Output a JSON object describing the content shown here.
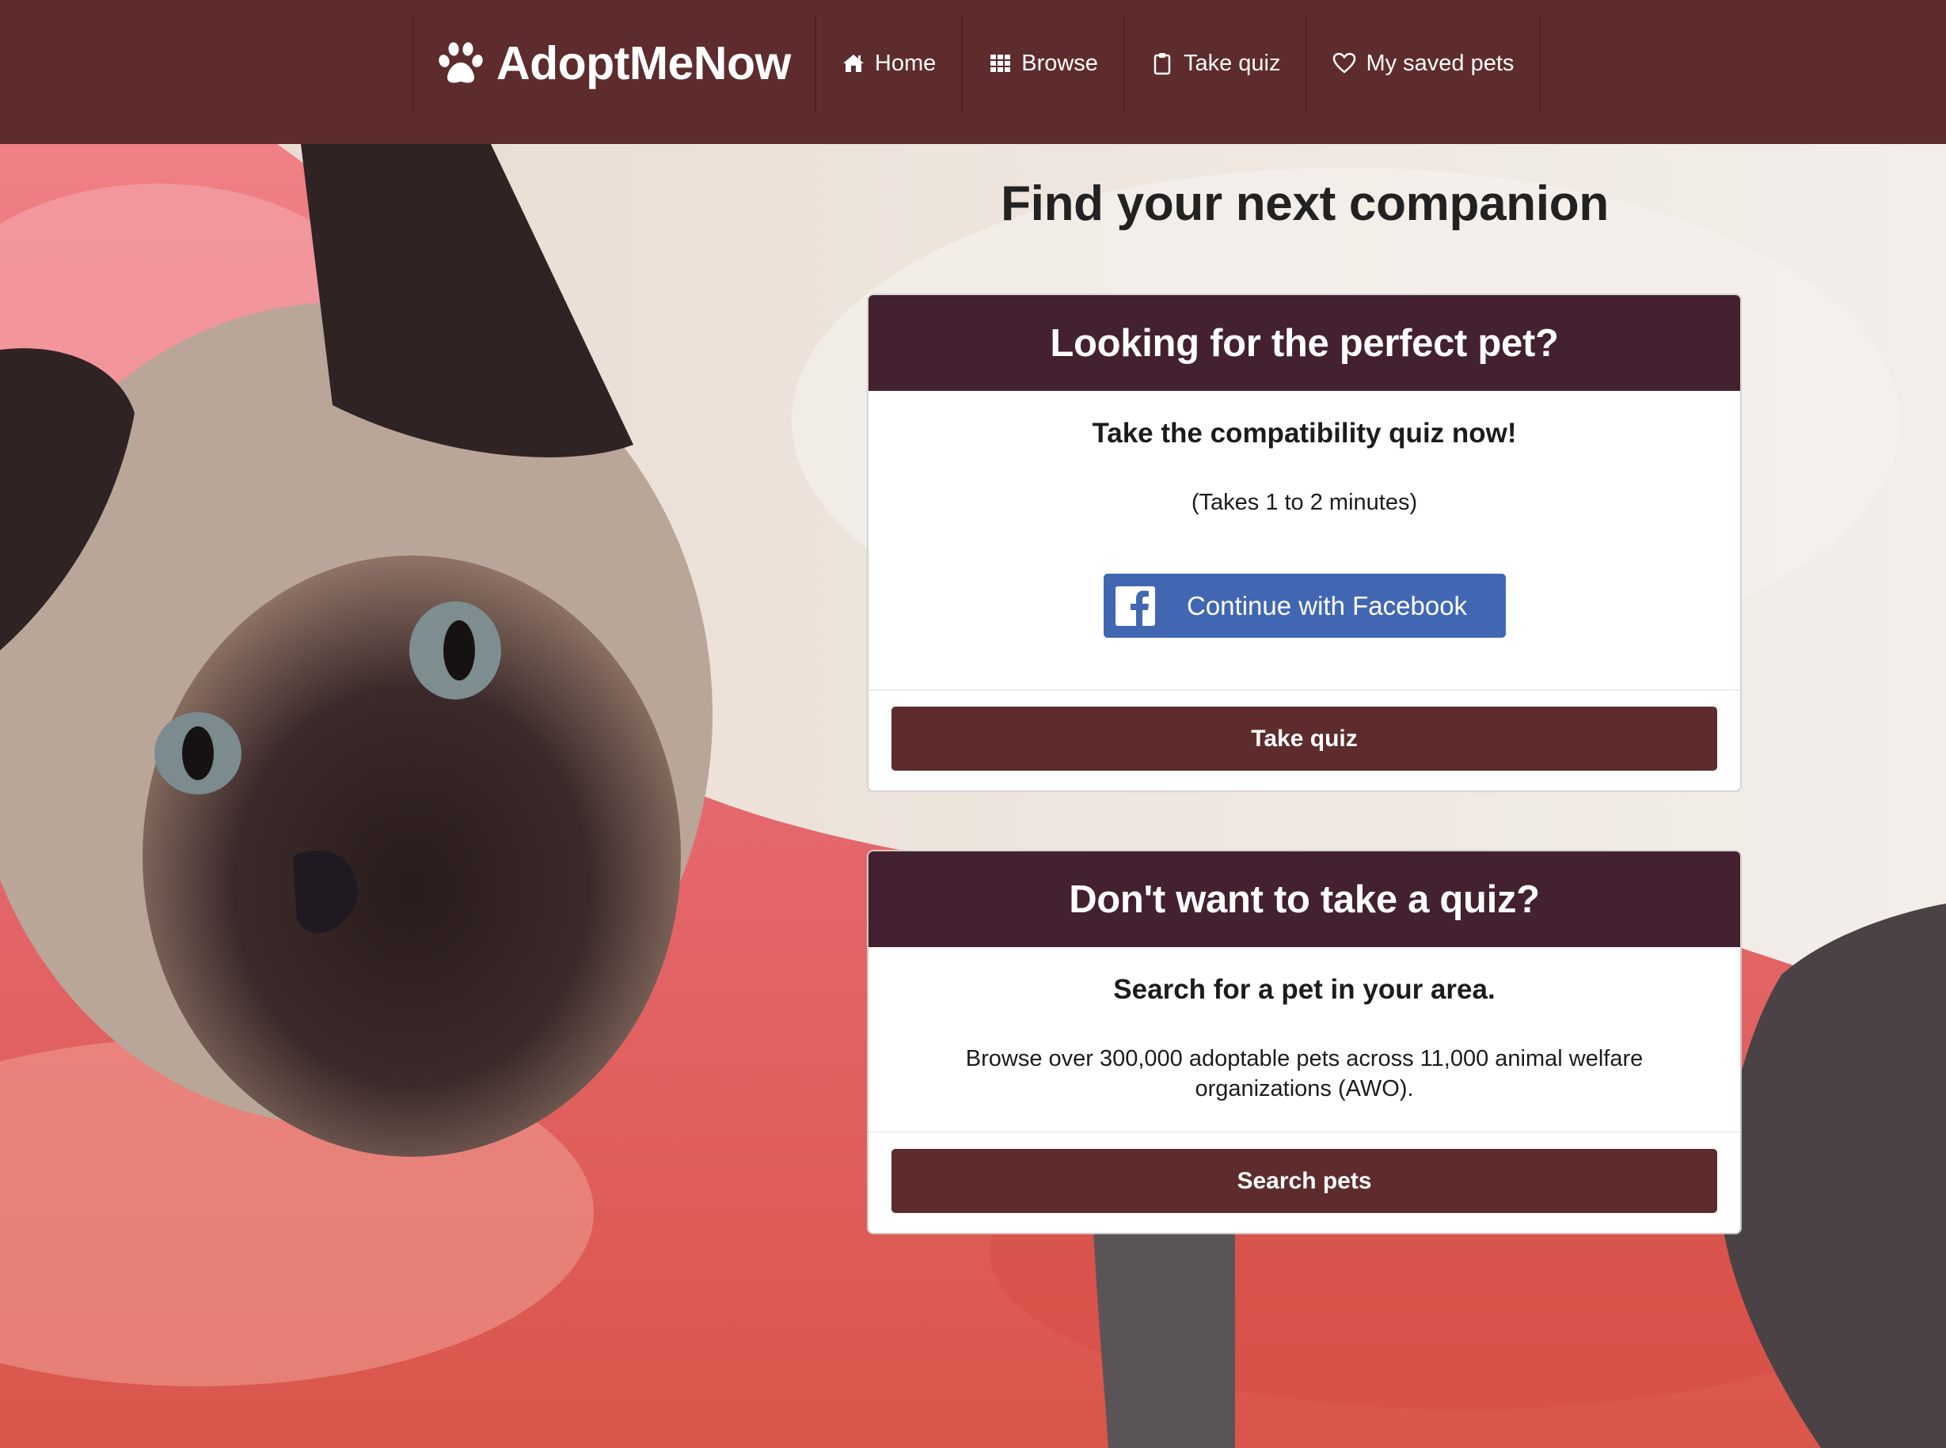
{
  "navbar": {
    "brand": {
      "name": "AdoptMeNow",
      "icon": "paw-icon"
    },
    "items": [
      {
        "label": "Home",
        "icon": "home-icon"
      },
      {
        "label": "Browse",
        "icon": "grid-icon"
      },
      {
        "label": "Take quiz",
        "icon": "clipboard-icon"
      },
      {
        "label": "My saved pets",
        "icon": "heart-icon"
      }
    ]
  },
  "hero": {
    "title": "Find your next companion"
  },
  "quiz_card": {
    "header": "Looking for the perfect pet?",
    "lead": "Take the compatibility quiz now!",
    "note": "(Takes 1 to 2 minutes)",
    "facebook_button": {
      "label": "Continue with Facebook",
      "icon": "facebook-icon"
    },
    "button": "Take quiz"
  },
  "search_card": {
    "header": "Don't want to take a quiz?",
    "lead": "Search for a pet in your area.",
    "note": "Browse over 300,000 adoptable pets across 11,000 animal welfare organizations (AWO).",
    "button": "Search pets"
  },
  "colors": {
    "navbar": "#5e2c2c",
    "card_header": "#432130",
    "primary_button": "#5e2c2c",
    "facebook": "#4267b2"
  }
}
